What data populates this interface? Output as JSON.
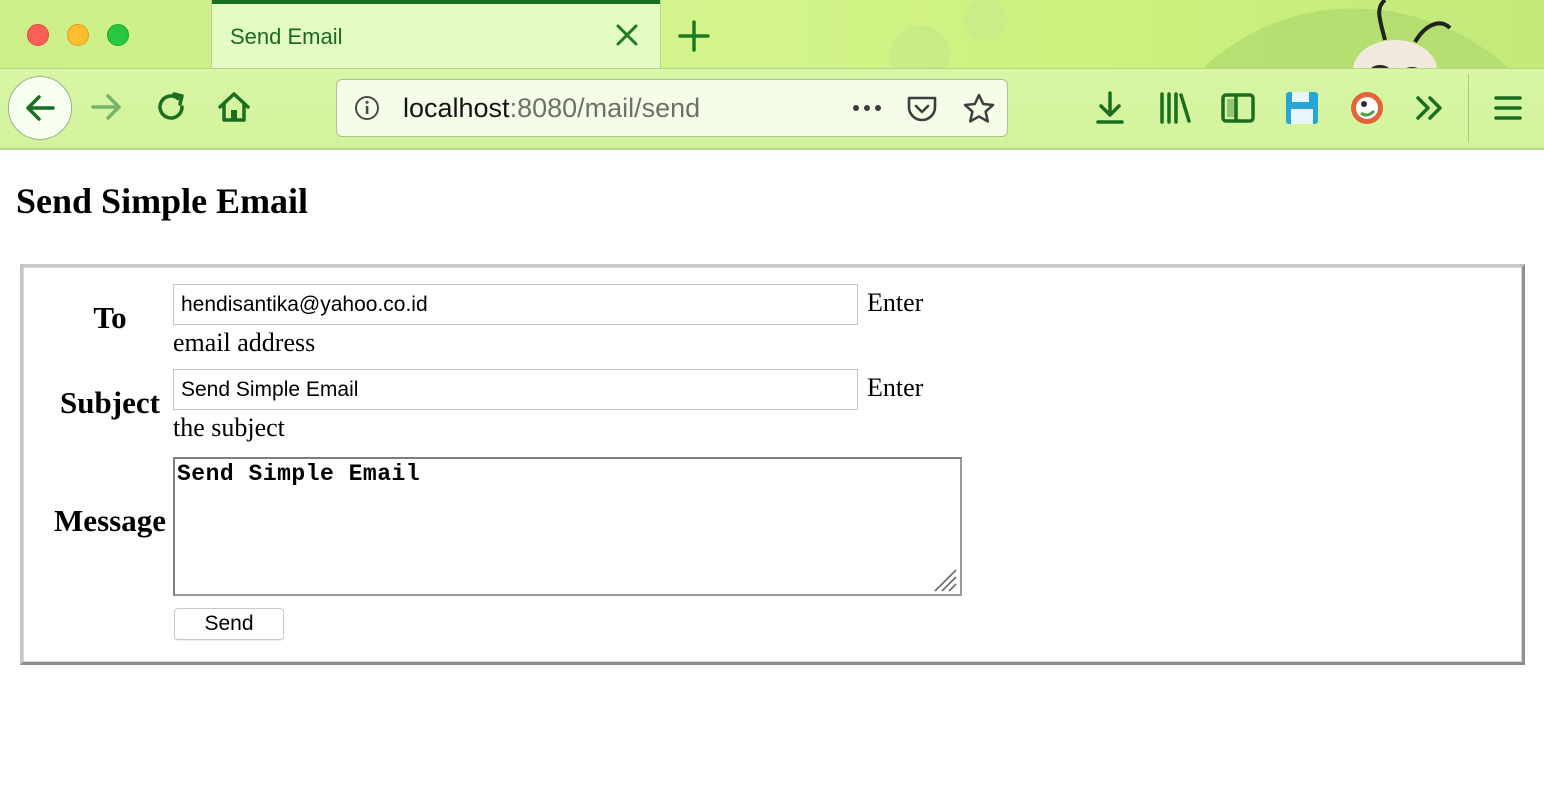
{
  "window": {
    "controls": [
      "close-dot",
      "minimize-dot",
      "zoom-dot"
    ],
    "control_colors": {
      "close": "#fc5f57",
      "minimize": "#fdbd2e",
      "zoom": "#27c840"
    }
  },
  "tabs": [
    {
      "title": "Send Email",
      "active": true
    }
  ],
  "navbar": {
    "url_host": "localhost",
    "url_path": ":8080/mail/send",
    "icons": [
      "back-arrow-icon",
      "forward-arrow-icon",
      "reload-icon",
      "home-icon",
      "site-info-icon",
      "page-actions-icon",
      "pocket-icon",
      "bookmark-star-icon",
      "downloads-icon",
      "library-icon",
      "sidebar-icon",
      "save-icon",
      "duckduckgo-icon",
      "overflow-chevrons-icon",
      "hamburger-menu-icon"
    ]
  },
  "theme": {
    "accent": "#1a6b1f",
    "toolbar_bg": "#d3f48c"
  },
  "page": {
    "title": "Send Simple Email",
    "form": {
      "to_label": "To",
      "to_value": "hendisantika@yahoo.co.id",
      "to_hint_line1": "Enter",
      "to_hint_line2": "email address",
      "subject_label": "Subject",
      "subject_value": "Send Simple Email",
      "subject_hint_line1": "Enter",
      "subject_hint_line2": "the subject",
      "message_label": "Message",
      "message_value": "Send Simple Email",
      "send_label": "Send"
    }
  }
}
